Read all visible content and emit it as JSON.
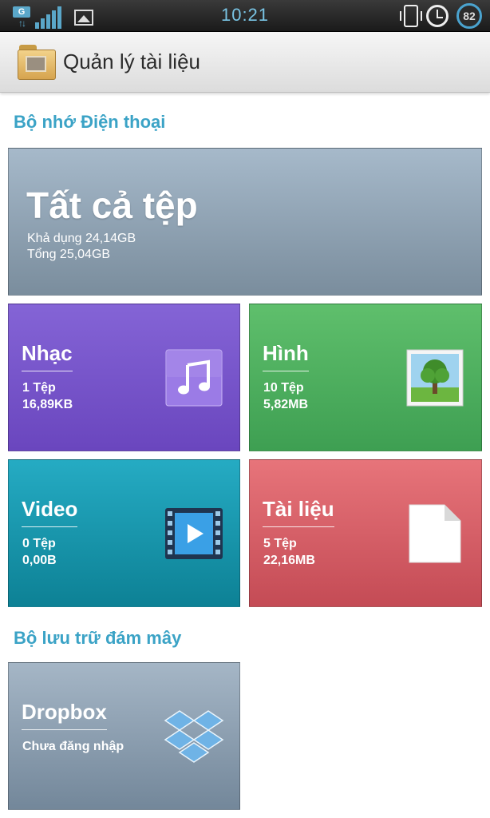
{
  "status_bar": {
    "network": "G",
    "time": "10:21",
    "battery": "82"
  },
  "app": {
    "title": "Quản lý tài liệu"
  },
  "phone_storage": {
    "section_title": "Bộ nhớ Điện thoại",
    "all_files": {
      "title": "Tất cả tệp",
      "available": "Khả dụng 24,14GB",
      "total": "Tổng 25,04GB"
    },
    "tiles": [
      {
        "label": "Nhạc",
        "count": "1 Tệp",
        "size": "16,89KB",
        "icon": "music-note-icon",
        "color": "#7455c9"
      },
      {
        "label": "Hình",
        "count": "10 Tệp",
        "size": "5,82MB",
        "icon": "tree-photo-icon",
        "color": "#4caf5e"
      },
      {
        "label": "Video",
        "count": "0 Tệp",
        "size": "0,00B",
        "icon": "video-film-icon",
        "color": "#1498ae"
      },
      {
        "label": "Tài liệu",
        "count": "5 Tệp",
        "size": "22,16MB",
        "icon": "document-icon",
        "color": "#d75f67"
      }
    ]
  },
  "cloud_storage": {
    "section_title": "Bộ lưu trữ đám mây",
    "dropbox": {
      "label": "Dropbox",
      "status": "Chưa đăng nhập",
      "icon": "dropbox-icon"
    }
  }
}
